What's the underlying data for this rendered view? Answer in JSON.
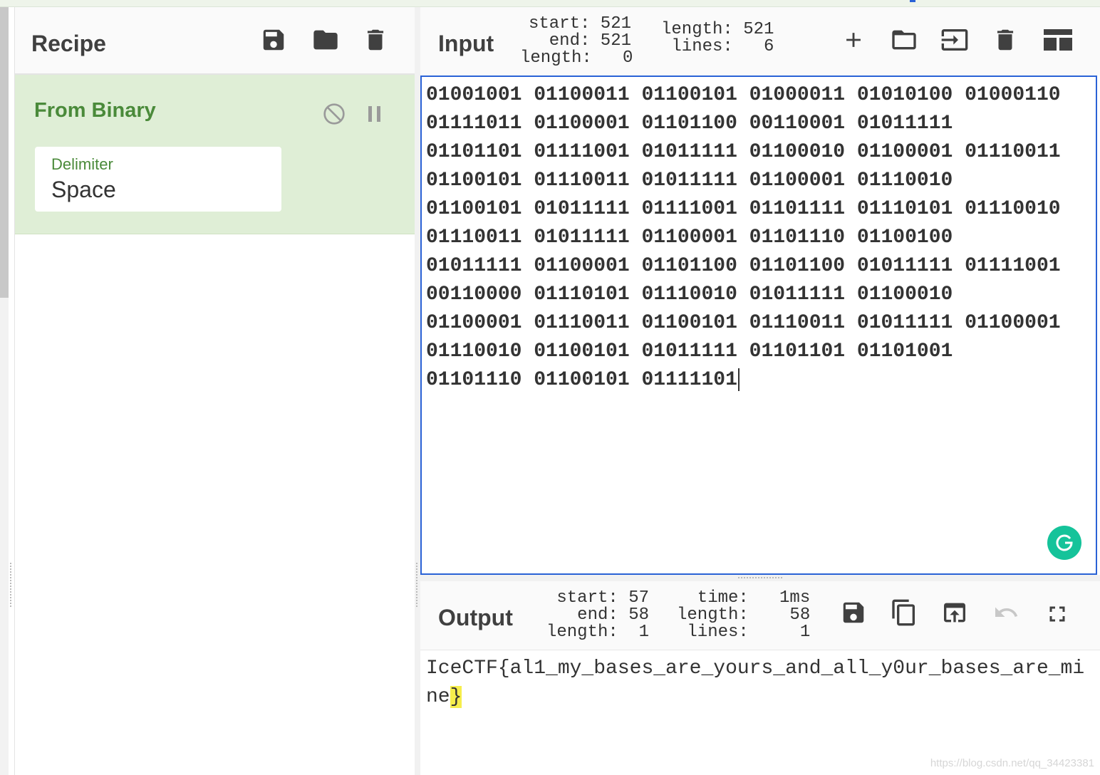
{
  "recipe": {
    "title": "Recipe",
    "operation": {
      "name": "From Binary",
      "arg_label": "Delimiter",
      "arg_value": "Space"
    }
  },
  "input": {
    "title": "Input",
    "stats_left": "start: 521\n  end: 521\nlength:   0",
    "stats_right": "length: 521\n lines:   6",
    "lines": [
      "01001001 01100011 01100101 01000011 01010100 01000110",
      "01111011 01100001 01101100 00110001 01011111",
      "01101101 01111001 01011111 01100010 01100001 01110011",
      "01100101 01110011 01011111 01100001 01110010",
      "01100101 01011111 01111001 01101111 01110101 01110010",
      "01110011 01011111 01100001 01101110 01100100",
      "01011111 01100001 01101100 01101100 01011111 01111001",
      "00110000 01110101 01110010 01011111 01100010",
      "01100001 01110011 01100101 01110011 01011111 01100001",
      "01110010 01100101 01011111 01101101 01101001",
      "01101110 01100101 01111101"
    ]
  },
  "output": {
    "title": "Output",
    "stats_left": "start: 57\n  end: 58\nlength:  1",
    "stats_right": "  time:   1ms\nlength:    58\n lines:     1",
    "line1": "IceCTF{al1_my_bases_are_yours_and_all_y0ur_bases_are_mi",
    "line2_text": "ne",
    "line2_highlight": "}"
  },
  "watermark": "https://blog.csdn.net/qq_34423381",
  "icons": {
    "recipe": [
      "save-icon",
      "folder-icon",
      "trash-icon"
    ],
    "operation": [
      "disable-icon",
      "pause-icon"
    ],
    "input": [
      "plus-icon",
      "folder-icon",
      "input-icon",
      "trash-icon",
      "layout-icon"
    ],
    "output": [
      "save-icon",
      "copy-icon",
      "replace-input-icon",
      "undo-icon",
      "fullscreen-icon"
    ]
  },
  "colors": {
    "accent_green": "#4a8a3a",
    "operation_bg": "#dfeed6",
    "focus_blue": "#2a62d6",
    "highlight": "#f6ee4c"
  }
}
